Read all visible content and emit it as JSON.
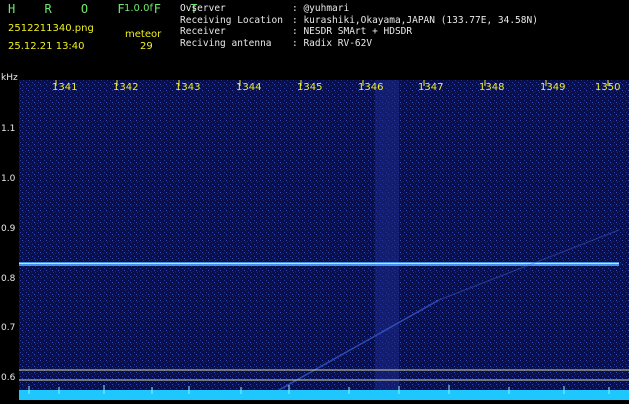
{
  "header": {
    "brand": "H R O F F T",
    "version": "1.0.0f",
    "filename": "2512211340.png",
    "event_type": "meteor",
    "datetime": "25.12.21 13:40",
    "count": "29"
  },
  "station_info": [
    {
      "label": "Ovserver",
      "value": ": @yuhmari"
    },
    {
      "label": "Receiving Location",
      "value": ": kurashiki,Okayama,JAPAN (133.77E, 34.58N)"
    },
    {
      "label": "Receiver",
      "value": ": NESDR SMArt + HDSDR"
    },
    {
      "label": "Reciving antenna",
      "value": ": Radix RV-62V"
    }
  ],
  "y_axis": {
    "unit": "kHz",
    "ticks": [
      "1.1",
      "1.0",
      "0.9",
      "0.8",
      "0.7",
      "0.6"
    ]
  },
  "x_axis": {
    "ticks": [
      "1341",
      "1342",
      "1343",
      "1344",
      "1345",
      "1346",
      "1347",
      "1348",
      "1349",
      "1350"
    ]
  },
  "colors": {
    "background": "#0a0f4a",
    "carrier": "#4fa7ff",
    "header_green": "#6fe86f",
    "header_yellow": "#f0f020",
    "baseline": "#1ec8ff"
  }
}
